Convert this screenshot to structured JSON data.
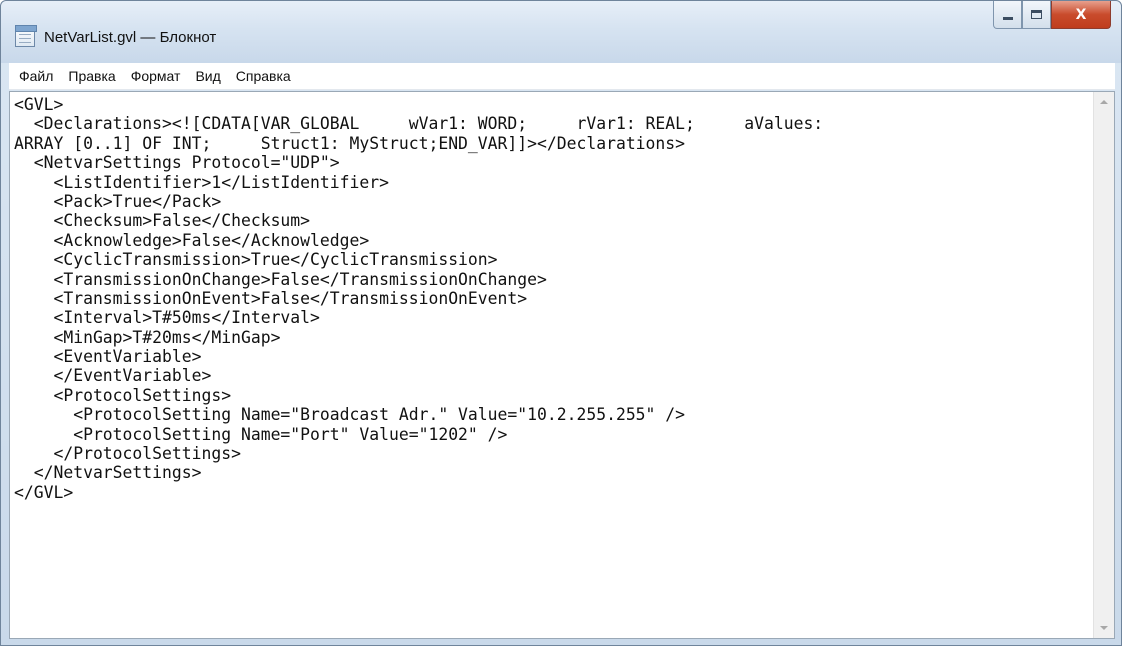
{
  "window": {
    "title": "NetVarList.gvl — Блокнот",
    "app_icon": "notepad-icon",
    "controls": {
      "minimize": "minimize-icon",
      "maximize": "maximize-icon",
      "close_glyph": "X"
    }
  },
  "menu": [
    "Файл",
    "Правка",
    "Формат",
    "Вид",
    "Справка"
  ],
  "editor": {
    "lines": [
      "<GVL>",
      "  <Declarations><![CDATA[VAR_GLOBAL     wVar1: WORD;     rVar1: REAL;     aValues:",
      "ARRAY [0..1] OF INT;     Struct1: MyStruct;END_VAR]]></Declarations>",
      "  <NetvarSettings Protocol=\"UDP\">",
      "    <ListIdentifier>1</ListIdentifier>",
      "    <Pack>True</Pack>",
      "    <Checksum>False</Checksum>",
      "    <Acknowledge>False</Acknowledge>",
      "    <CyclicTransmission>True</CyclicTransmission>",
      "    <TransmissionOnChange>False</TransmissionOnChange>",
      "    <TransmissionOnEvent>False</TransmissionOnEvent>",
      "    <Interval>T#50ms</Interval>",
      "    <MinGap>T#20ms</MinGap>",
      "    <EventVariable>",
      "    </EventVariable>",
      "    <ProtocolSettings>",
      "      <ProtocolSetting Name=\"Broadcast Adr.\" Value=\"10.2.255.255\" />",
      "      <ProtocolSetting Name=\"Port\" Value=\"1202\" />",
      "    </ProtocolSettings>",
      "  </NetvarSettings>",
      "</GVL>"
    ]
  },
  "colors": {
    "close_button": "#c94b2c",
    "titlebar": "#d6e3f1"
  }
}
